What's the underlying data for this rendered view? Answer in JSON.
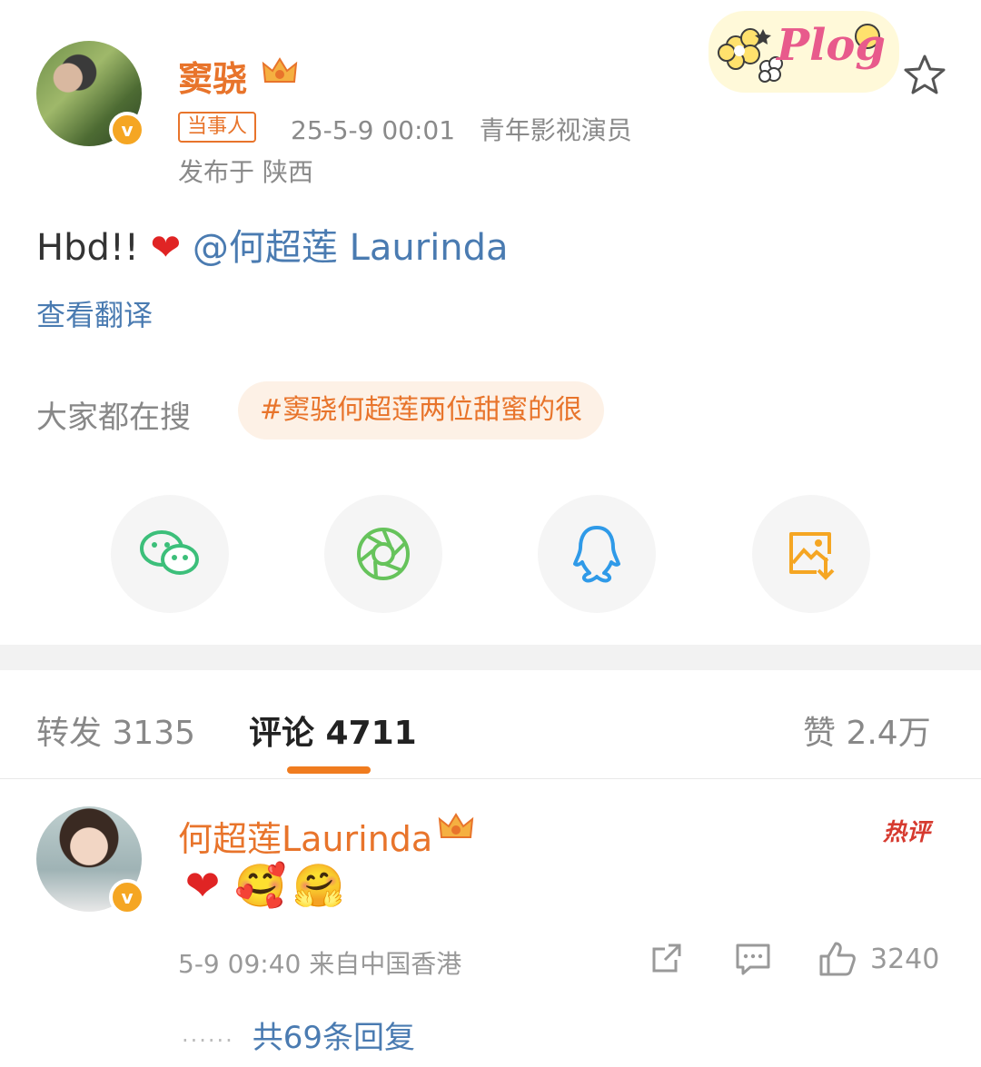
{
  "post": {
    "author": "窦骁",
    "tag": "当事人",
    "timestamp": "25-5-9 00:01",
    "role": "青年影视演员",
    "location": "发布于 陕西",
    "sticker_text": "Plog",
    "content_text": "Hbd!!",
    "content_heart": "❤",
    "mention": "@何超莲 Laurinda",
    "translate": "查看翻译",
    "search_label": "大家都在搜",
    "hot_search": "#窦骁何超莲两位甜蜜的很",
    "verified_badge": "v",
    "icons": [
      "star-icon",
      "crown-icon"
    ]
  },
  "share": {
    "buttons": [
      "wechat-icon",
      "moments-icon",
      "qq-icon",
      "save-image-icon"
    ],
    "colors": {
      "wechat": "#3cbf7a",
      "moments": "#66c35b",
      "qq": "#2f9ae8",
      "save": "#f5a623"
    }
  },
  "tabs": {
    "repost": "转发 3135",
    "comments": "评论 4711",
    "likes": "赞 2.4万"
  },
  "comment": {
    "author": "何超莲Laurinda",
    "hot_badge": "热评",
    "emojis": [
      "❤",
      "🥰",
      "🤗"
    ],
    "time_location": "5-9 09:40 来自中国香港",
    "like_count": "3240",
    "replies": "共69条回复",
    "replies_dots": "······"
  },
  "accent_color": "#e8742b",
  "link_color": "#4a7bb1"
}
